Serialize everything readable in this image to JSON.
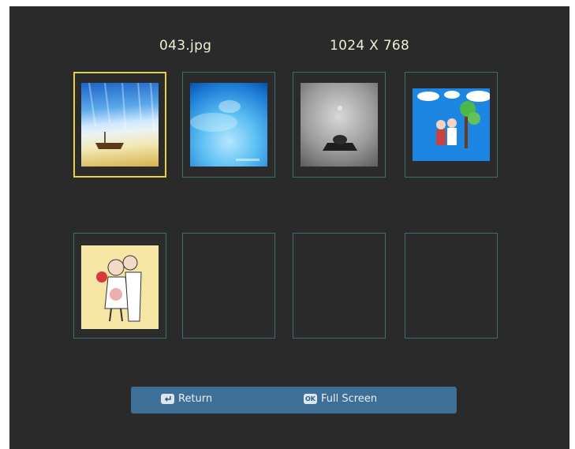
{
  "header": {
    "filename": "043.jpg",
    "resolution": "1024 X 768"
  },
  "thumbnails": [
    {
      "image": "beach-boat-photo",
      "selected": true
    },
    {
      "image": "blue-abstract-photo",
      "selected": false
    },
    {
      "image": "gray-object-photo",
      "selected": false
    },
    {
      "image": "cartoon-couple-tree",
      "selected": false
    },
    {
      "image": "cartoon-couple-dancing",
      "selected": false
    },
    {
      "image": "",
      "selected": false
    },
    {
      "image": "",
      "selected": false
    },
    {
      "image": "",
      "selected": false
    }
  ],
  "footer": {
    "return_icon": "return-icon",
    "return_label": "Return",
    "ok_icon": "ok-icon",
    "ok_icon_text": "OK",
    "fullscreen_label": "Full Screen"
  },
  "colors": {
    "screen_bg": "#2a2a2a",
    "cell_border": "#3f6d73",
    "selected_border": "#e6d23b",
    "footer_bg": "#3e6f97",
    "header_text": "#f0efd6"
  }
}
